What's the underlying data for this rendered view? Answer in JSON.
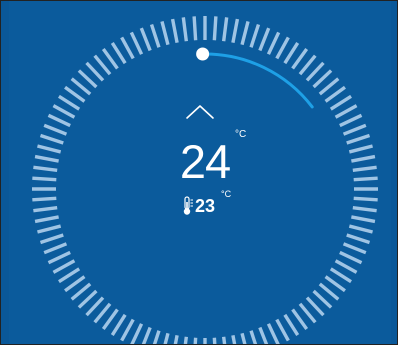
{
  "thermostat": {
    "setpoint": "24",
    "setpoint_unit": "°C",
    "current_temperature": "23",
    "current_unit": "°C",
    "setpoint_level": 0.16
  },
  "icons": {
    "increase": "chevron-up-icon",
    "current_temperature": "thermometer-icon",
    "knob": "dial-knob-handle"
  },
  "colors": {
    "background": "#0b5b9c",
    "ticks": "#9fc4e4",
    "progress_arc": "#1ea0e6",
    "text": "#ffffff"
  }
}
